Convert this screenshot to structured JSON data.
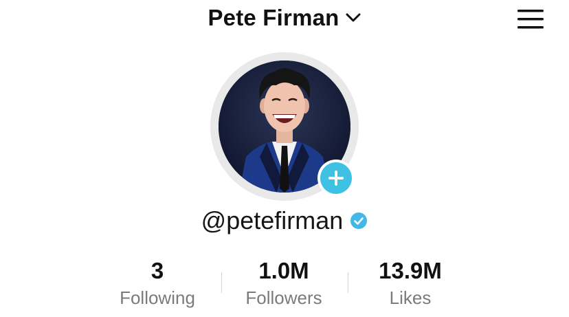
{
  "header": {
    "title": "Pete Firman",
    "chevron_icon": "chevron-down-icon",
    "menu_icon": "hamburger-menu-icon"
  },
  "profile": {
    "avatar_alt": "profile photo",
    "follow_icon": "plus-icon",
    "username": "@petefirman",
    "verified_icon": "verified-check-icon"
  },
  "stats": [
    {
      "value": "3",
      "label": "Following"
    },
    {
      "value": "1.0M",
      "label": "Followers"
    },
    {
      "value": "13.9M",
      "label": "Likes"
    }
  ],
  "colors": {
    "accent": "#3fc1e3",
    "verified": "#41b8e8",
    "secondary_text": "#7b7b7b",
    "primary_text": "#111111"
  }
}
